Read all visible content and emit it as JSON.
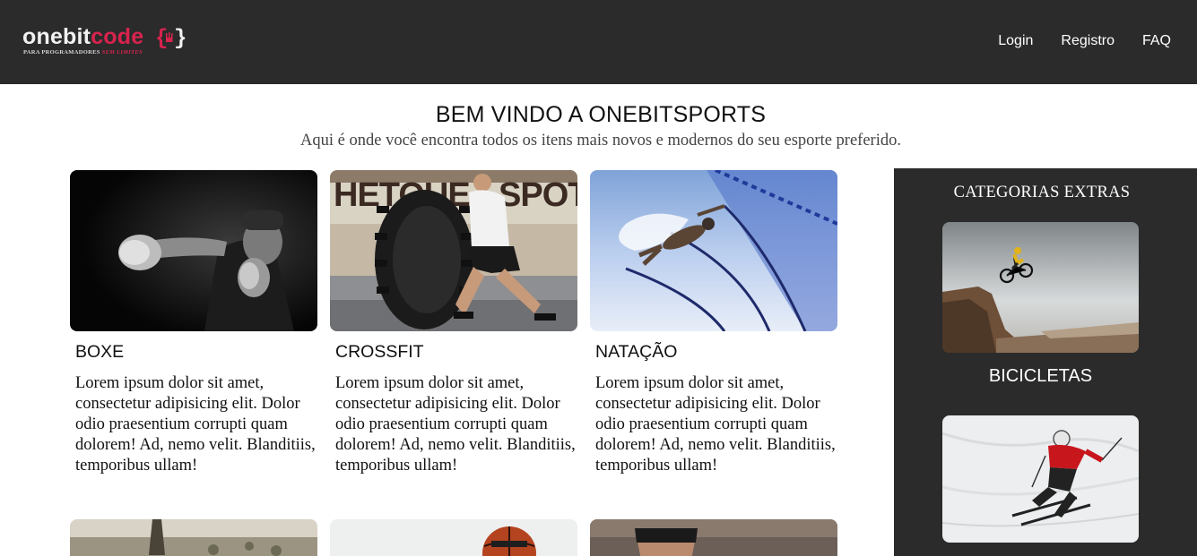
{
  "header": {
    "logo": {
      "word_main": "onebit",
      "word_accent": "code",
      "tagline_main": "PARA PROGRAMADORES",
      "tagline_accent": "SEM LIMITES"
    },
    "nav": [
      {
        "label": "Login"
      },
      {
        "label": "Registro"
      },
      {
        "label": "FAQ"
      }
    ]
  },
  "hero": {
    "title": "BEM VINDO A ONEBITSPORTS",
    "subtitle": "Aqui é onde você encontra todos os itens mais novos e modernos do seu esporte preferido."
  },
  "cards": [
    {
      "title": "BOXE",
      "text": "Lorem ipsum dolor sit amet, consectetur adipisicing elit. Dolor odio praesentium corrupti quam dolorem! Ad, nemo velit. Blanditiis, temporibus ullam!"
    },
    {
      "title": "CROSSFIT",
      "text": "Lorem ipsum dolor sit amet, consectetur adipisicing elit. Dolor odio praesentium corrupti quam dolorem! Ad, nemo velit. Blanditiis, temporibus ullam!"
    },
    {
      "title": "NATAÇÃO",
      "text": "Lorem ipsum dolor sit amet, consectetur adipisicing elit. Dolor odio praesentium corrupti quam dolorem! Ad, nemo velit. Blanditiis, temporibus ullam!"
    }
  ],
  "sidebar": {
    "title": "CATEGORIAS EXTRAS",
    "items": [
      {
        "label": "BICICLETAS"
      }
    ]
  },
  "colors": {
    "header_bg": "#2b2b2b",
    "accent": "#d8234e",
    "sidebar_bg": "#2b2b2b"
  }
}
